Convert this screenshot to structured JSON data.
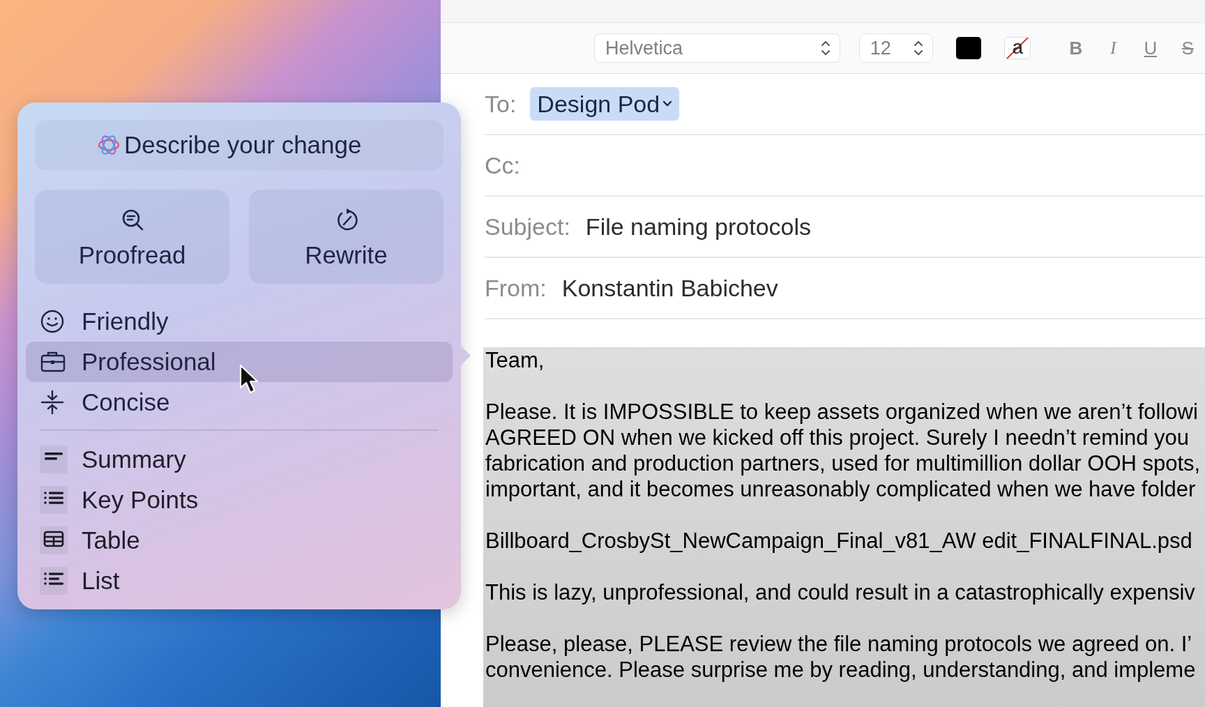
{
  "writing_tools": {
    "describe": {
      "placeholder": "Describe your change"
    },
    "actions": [
      {
        "label": "Proofread"
      },
      {
        "label": "Rewrite"
      }
    ],
    "tones": [
      {
        "label": "Friendly",
        "selected": false
      },
      {
        "label": "Professional",
        "selected": true
      },
      {
        "label": "Concise",
        "selected": false
      }
    ],
    "formats": [
      {
        "label": "Summary"
      },
      {
        "label": "Key Points"
      },
      {
        "label": "Table"
      },
      {
        "label": "List"
      }
    ]
  },
  "toolbar": {
    "font": "Helvetica",
    "size": "12",
    "highlight_glyph": "a",
    "styles": [
      "B",
      "I",
      "U",
      "S"
    ]
  },
  "header": [
    {
      "label": "To:",
      "value": "Design Pod",
      "kind": "token"
    },
    {
      "label": "Cc:"
    },
    {
      "label": "Subject:",
      "value": "File naming protocols",
      "kind": "text"
    },
    {
      "label": "From:",
      "value": "Konstantin Babichev",
      "kind": "text"
    }
  ],
  "body": {
    "selected": true,
    "paragraphs": [
      [
        "Team,"
      ],
      [
        "Please. It is IMPOSSIBLE to keep assets organized when we aren’t followi",
        "AGREED ON when we kicked off this project. Surely I needn’t remind you",
        "fabrication and production partners, used for multimillion dollar OOH spots,",
        "important, and it becomes unreasonably complicated when we have folder"
      ],
      [
        "Billboard_CrosbySt_NewCampaign_Final_v81_AW edit_FINALFINAL.psd"
      ],
      [
        "This is lazy, unprofessional, and could result in a catastrophically expensiv"
      ],
      [
        "Please, please, PLEASE review the file naming protocols we agreed on. I’",
        "convenience. Please surprise me by reading, understanding, and impleme"
      ]
    ]
  }
}
